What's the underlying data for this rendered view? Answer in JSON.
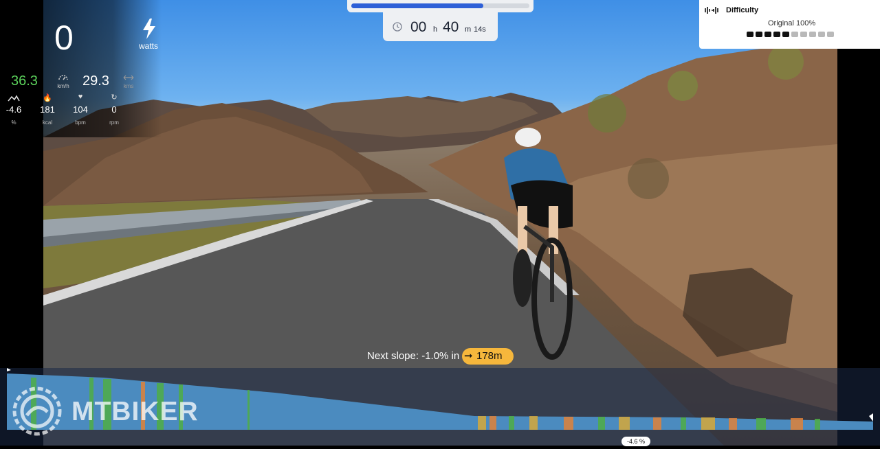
{
  "hud": {
    "power": {
      "value": "0",
      "unit": "watts"
    },
    "speed": {
      "value": "36.3",
      "unit": "km/h",
      "color": "#5cd35c"
    },
    "distance": {
      "value": "29.3",
      "unit": "kms"
    },
    "slope": {
      "value": "-4.6",
      "unit": "%"
    },
    "calories": {
      "value": "181",
      "unit": "kcal"
    },
    "heart_rate": {
      "value": "104",
      "unit": "bpm"
    },
    "cadence": {
      "value": "0",
      "unit": "rpm"
    }
  },
  "progress": {
    "fraction": 0.74,
    "color": "#2d5fd7"
  },
  "timer": {
    "hours": "00",
    "h_label": "h",
    "minutes": "40",
    "m_label": "m",
    "seconds": "14s"
  },
  "difficulty": {
    "title": "Difficulty",
    "value": "Original 100%",
    "level_filled": 5,
    "level_total": 10
  },
  "next_slope": {
    "label": "Next slope: -1.0% in",
    "distance": "178m",
    "pill_color": "#f6b73c"
  },
  "watermark": "MTBIKER",
  "profile": {
    "current_grade": "-4.6 %"
  }
}
